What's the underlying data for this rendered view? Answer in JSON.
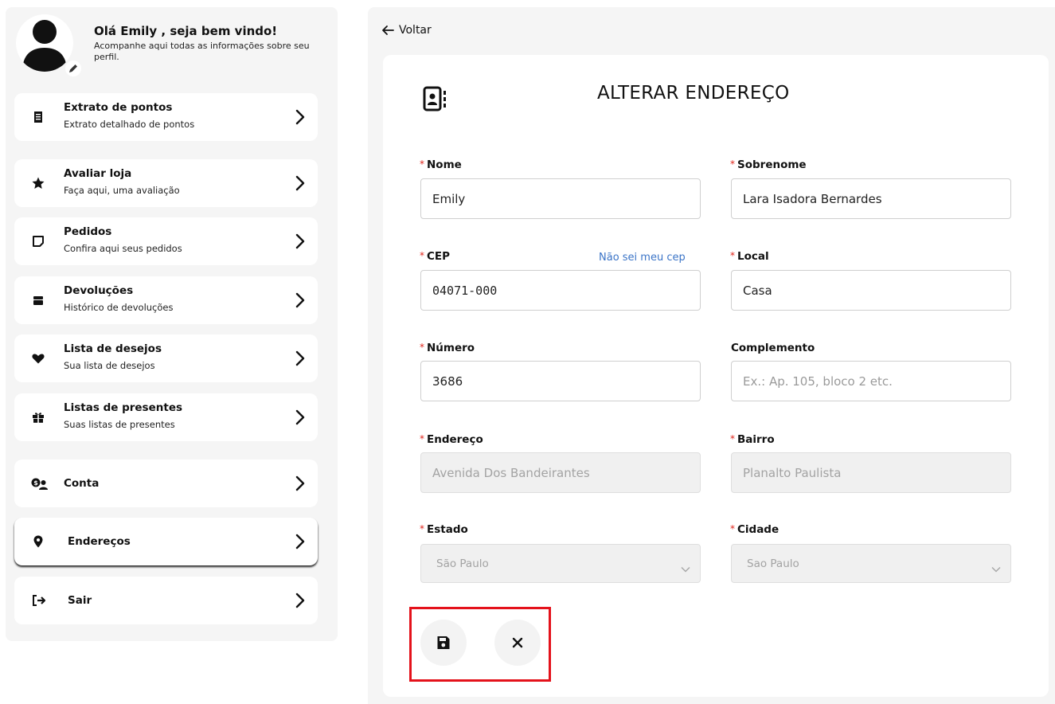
{
  "profile": {
    "greeting": "Olá Emily , seja bem vindo!",
    "subtitle": "Acompanhe aqui todas as informações sobre seu perfil."
  },
  "menu": [
    {
      "title": "Extrato de pontos",
      "subtitle": "Extrato detalhado de pontos",
      "icon": "receipt-icon"
    },
    {
      "title": "Avaliar loja",
      "subtitle": "Faça aqui, uma avaliação",
      "icon": "star-icon"
    },
    {
      "title": "Pedidos",
      "subtitle": "Confira aqui seus pedidos",
      "icon": "note-icon"
    },
    {
      "title": "Devoluções",
      "subtitle": "Histórico de devoluções",
      "icon": "box-icon"
    },
    {
      "title": "Lista de desejos",
      "subtitle": "Sua lista de desejos",
      "icon": "heart-icon"
    },
    {
      "title": "Listas de presentes",
      "subtitle": "Suas listas de presentes",
      "icon": "gift-icon"
    },
    {
      "title": "Conta",
      "icon": "account-icon"
    },
    {
      "title": "Endereços",
      "icon": "location-pin-icon",
      "active": true
    },
    {
      "title": "Sair",
      "icon": "logout-icon"
    }
  ],
  "nav": {
    "back_label": "Voltar"
  },
  "form": {
    "title": "ALTERAR ENDEREÇO",
    "cep_link": "Não sei meu cep",
    "fields": {
      "nome": {
        "label": "Nome",
        "value": "Emily",
        "required": true
      },
      "sobrenome": {
        "label": "Sobrenome",
        "value": "Lara Isadora Bernardes",
        "required": true
      },
      "cep": {
        "label": "CEP",
        "value": "04071-000",
        "required": true
      },
      "local": {
        "label": "Local",
        "value": "Casa",
        "required": true
      },
      "numero": {
        "label": "Número",
        "value": "3686",
        "required": true
      },
      "complemento": {
        "label": "Complemento",
        "placeholder": "Ex.: Ap. 105, bloco 2 etc.",
        "value": "",
        "required": false
      },
      "endereco": {
        "label": "Endereço",
        "value": "Avenida Dos Bandeirantes",
        "required": true,
        "disabled": true
      },
      "bairro": {
        "label": "Bairro",
        "value": "Planalto Paulista",
        "required": true,
        "disabled": true
      },
      "estado": {
        "label": "Estado",
        "value": "São Paulo",
        "required": true,
        "disabled": true
      },
      "cidade": {
        "label": "Cidade",
        "value": "Sao Paulo",
        "required": true,
        "disabled": true
      }
    },
    "required_mark": "*"
  },
  "colors": {
    "required": "#e0251b",
    "link": "#3b74c7",
    "highlight_box": "#e4121b",
    "panel_bg": "#f5f5f5"
  }
}
